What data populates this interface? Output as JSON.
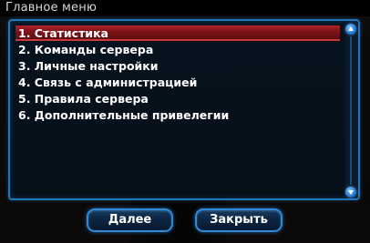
{
  "window": {
    "title": "Главное меню"
  },
  "menu": {
    "selected_index": 0,
    "items": [
      {
        "label": "1. Статистика"
      },
      {
        "label": "2. Команды сервера"
      },
      {
        "label": "3. Личные настройки"
      },
      {
        "label": "4. Связь с администрацией"
      },
      {
        "label": "5. Правила сервера"
      },
      {
        "label": "6. Дополнительные привелегии"
      }
    ]
  },
  "buttons": {
    "next_label": "Далее",
    "close_label": "Закрыть"
  },
  "colors": {
    "accent_blue": "#1f77b8",
    "selection_red": "#7a1418",
    "text": "#ffffff"
  },
  "icons": {
    "scroll_up": "scroll-up-arrow-icon",
    "scroll_down": "scroll-down-arrow-icon"
  }
}
